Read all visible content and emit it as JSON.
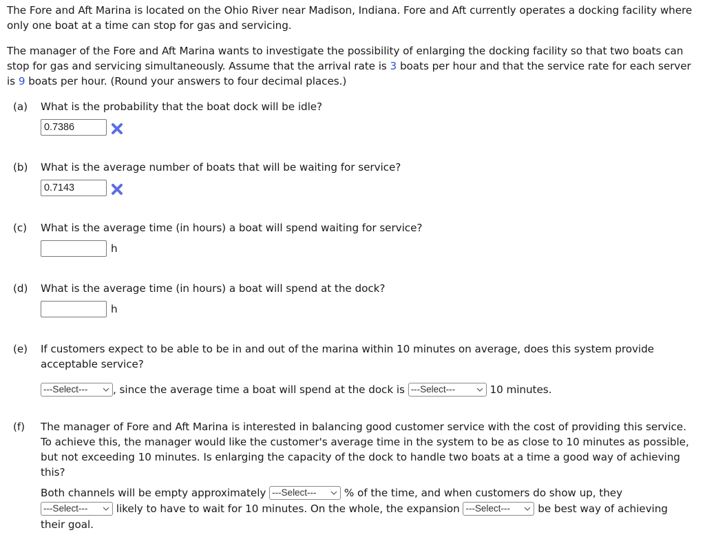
{
  "intro": {
    "paragraph1": "The Fore and Aft Marina is located on the Ohio River near Madison, Indiana. Fore and Aft currently operates a docking facility where only one boat at a time can stop for gas and servicing.",
    "paragraph2_a": "The manager of the Fore and Aft Marina wants to investigate the possibility of enlarging the docking facility so that two boats can stop for gas and servicing simultaneously. Assume that the arrival rate is ",
    "arrival_rate": "3",
    "paragraph2_b": " boats per hour and that the service rate for each server is ",
    "service_rate": "9",
    "paragraph2_c": " boats per hour. (Round your answers to four decimal places.)"
  },
  "parts": {
    "a": {
      "label": "(a)",
      "question": "What is the probability that the boat dock will be idle?",
      "answer_value": "0.7386",
      "status": "incorrect",
      "status_icon": "x-mark-icon",
      "status_color": "#5b6ee1"
    },
    "b": {
      "label": "(b)",
      "question": "What is the average number of boats that will be waiting for service?",
      "answer_value": "0.7143",
      "status": "incorrect",
      "status_icon": "x-mark-icon",
      "status_color": "#5b6ee1"
    },
    "c": {
      "label": "(c)",
      "question": "What is the average time (in hours) a boat will spend waiting for service?",
      "answer_value": "",
      "unit": "h"
    },
    "d": {
      "label": "(d)",
      "question": "What is the average time (in hours) a boat will spend at the dock?",
      "answer_value": "",
      "unit": "h"
    },
    "e": {
      "label": "(e)",
      "question": "If customers expect to be able to be in and out of the marina within 10 minutes on average, does this system provide acceptable service?",
      "select1": "---Select---",
      "text_mid": ", since the average time a boat will spend at the dock is",
      "select2": "---Select---",
      "text_end": "10 minutes."
    },
    "f": {
      "label": "(f)",
      "question": "The manager of Fore and Aft Marina is interested in balancing good customer service with the cost of providing this service. To achieve this, the manager would like the customer's average time in the system to be as close to 10 minutes as possible, but not exceeding 10 minutes. Is enlarging the capacity of the dock to handle two boats at a time a good way of achieving this?",
      "text1": "Both channels will be empty approximately",
      "select1": "---Select---",
      "text2": "% of the time, and when customers do show up, they",
      "select2": "---Select---",
      "text3": "likely to have to wait for 10 minutes. On the whole, the expansion",
      "select3": "---Select---",
      "text4": "be best way of achieving their goal."
    }
  }
}
